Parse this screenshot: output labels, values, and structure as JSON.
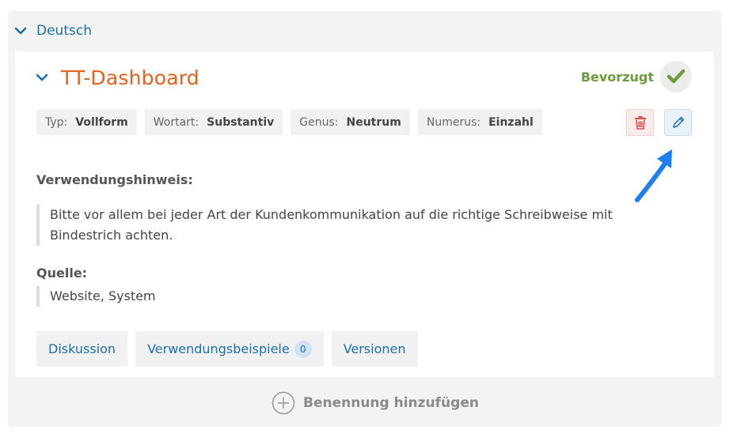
{
  "language": {
    "label": "Deutsch",
    "icon": "chevron-down-icon"
  },
  "term": {
    "title": "TT-Dashboard",
    "preferred_label": "Bevorzugt",
    "tags": [
      {
        "key": "Typ:",
        "value": "Vollform"
      },
      {
        "key": "Wortart:",
        "value": "Substantiv"
      },
      {
        "key": "Genus:",
        "value": "Neutrum"
      },
      {
        "key": "Numerus:",
        "value": "Einzahl"
      }
    ],
    "usage_label": "Verwendungshinweis:",
    "usage_text_line1": "Bitte vor allem bei jeder Art der Kundenkommunikation auf die richtige Schreibweise mit",
    "usage_text_line2": "Bindestrich achten.",
    "source_label": "Quelle:",
    "source_text": "Website, System"
  },
  "footer_tabs": {
    "discussion": "Diskussion",
    "examples": "Verwendungsbeispiele",
    "examples_count": "0",
    "versions": "Versionen"
  },
  "add_term_label": "Benennung hinzufügen",
  "colors": {
    "accent_blue": "#1b6fae",
    "title_orange": "#e8601c",
    "preferred_green": "#6a9c3a",
    "delete_red": "#d9534f",
    "arrow_blue": "#1e7ef0"
  }
}
